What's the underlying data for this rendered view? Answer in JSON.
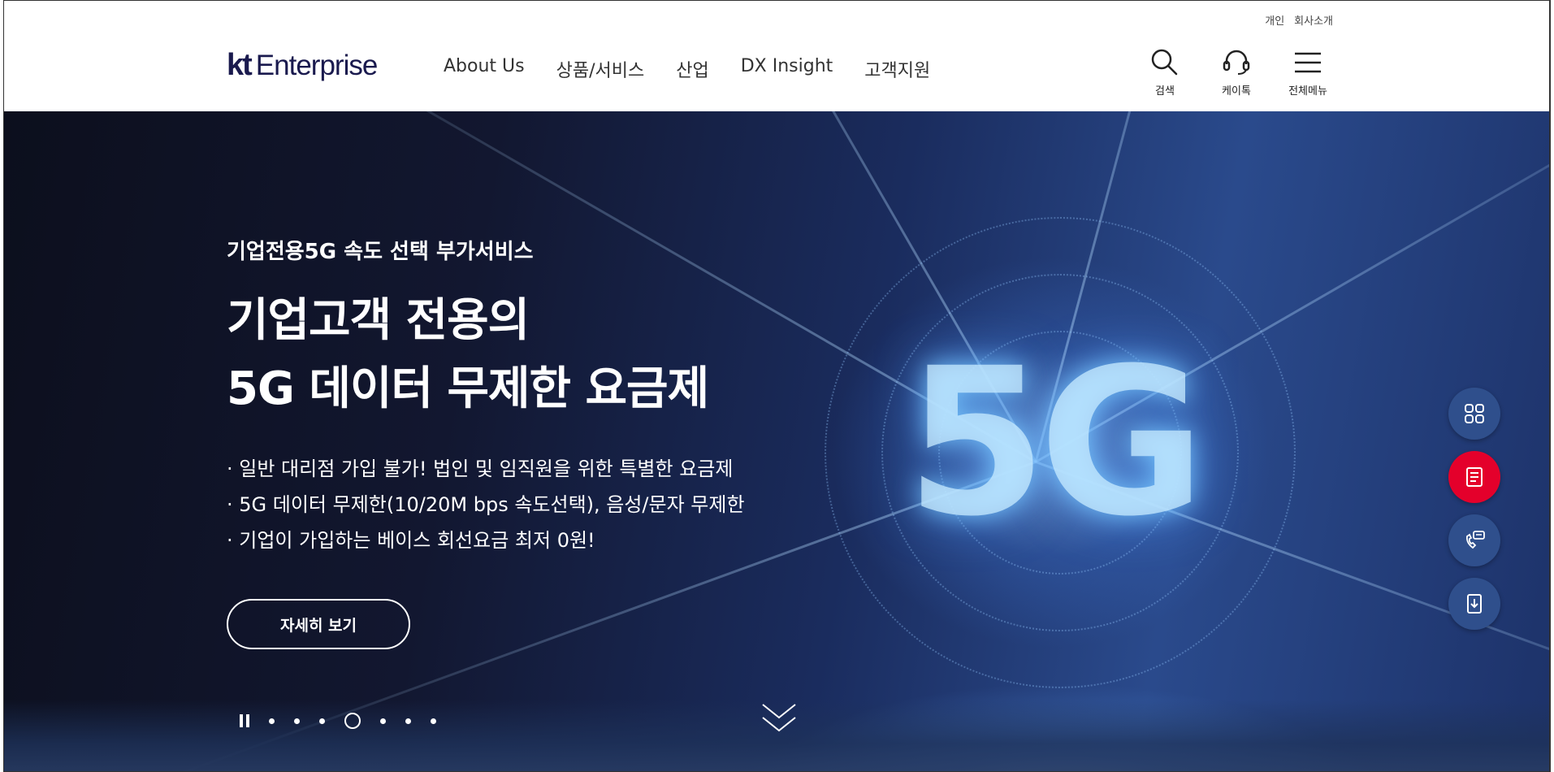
{
  "header": {
    "util_links": [
      "개인",
      "회사소개"
    ],
    "logo": {
      "kt": "kt",
      "name": "Enterprise"
    },
    "nav": [
      "About Us",
      "상품/서비스",
      "산업",
      "DX Insight",
      "고객지원"
    ],
    "tools": {
      "search": "검색",
      "ktalk": "케이톡",
      "menu": "전체메뉴"
    }
  },
  "hero": {
    "subtitle": "기업전용5G 속도 선택 부가서비스",
    "title_line1": "기업고객 전용의",
    "title_line2": "5G 데이터 무제한 요금제",
    "bullets": [
      "일반 대리점 가입 불가! 법인 및 임직원을 위한 특별한 요금제",
      "5G 데이터 무제한(10/20M bps 속도선택), 음성/문자 무제한",
      "기업이 가입하는 베이스 회선요금 최저 0원!"
    ],
    "cta": "자세히 보기",
    "graphic_text": "5G",
    "slides": {
      "total": 7,
      "active": 4
    }
  },
  "quick_menu": [
    "grid-icon",
    "document-icon",
    "phone-chat-icon",
    "download-icon"
  ],
  "colors": {
    "brand_navy": "#1a1a4e",
    "accent_red": "#e4002b",
    "quick_blue": "#2f4f8c"
  }
}
